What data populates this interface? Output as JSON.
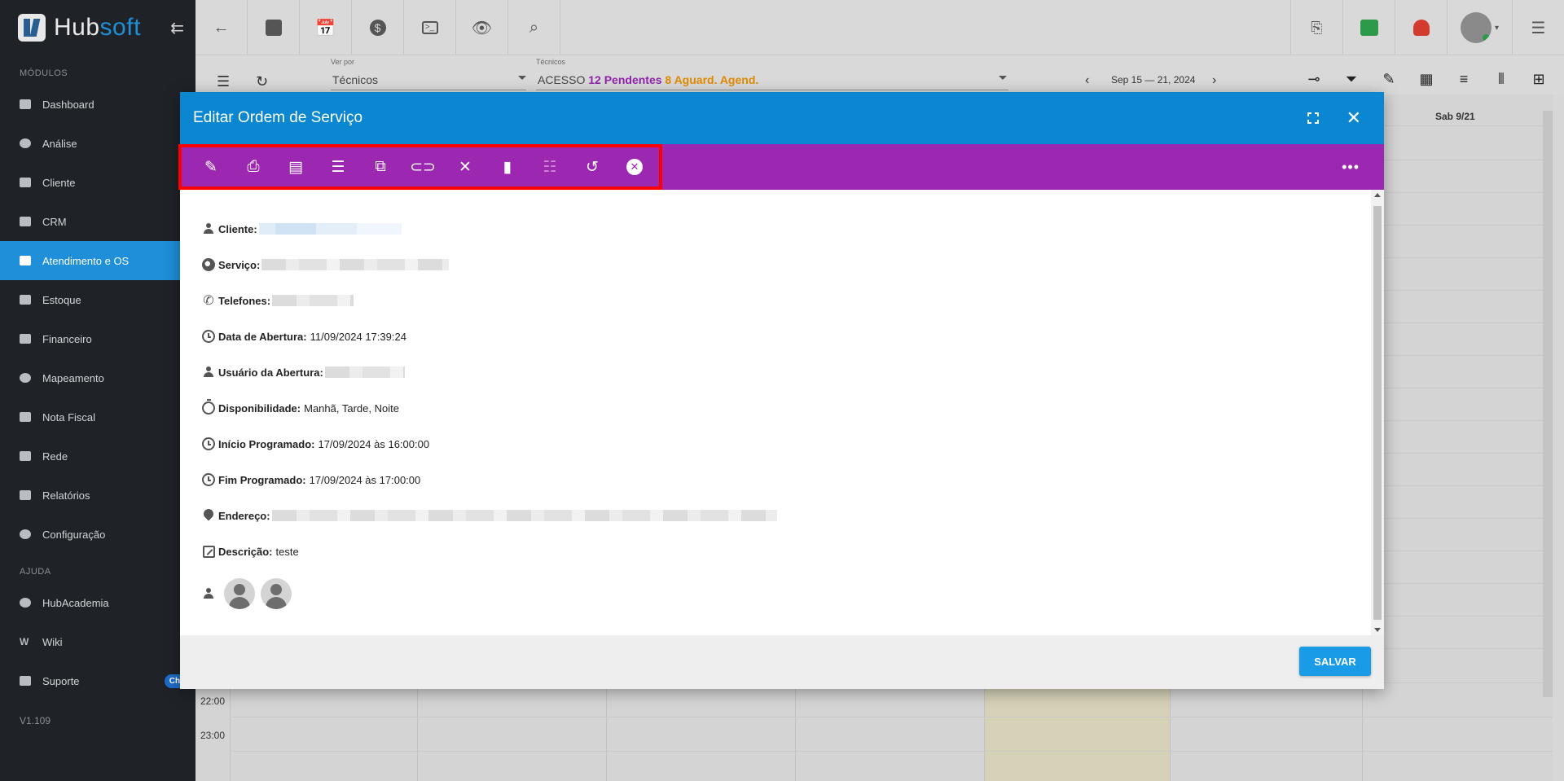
{
  "sidebar": {
    "brand_left": "Hub",
    "brand_right": "soft",
    "section_modules": "MÓDULOS",
    "items": [
      {
        "label": "Dashboard"
      },
      {
        "label": "Análise"
      },
      {
        "label": "Cliente"
      },
      {
        "label": "CRM"
      },
      {
        "label": "Atendimento e OS"
      },
      {
        "label": "Estoque"
      },
      {
        "label": "Financeiro"
      },
      {
        "label": "Mapeamento"
      },
      {
        "label": "Nota Fiscal"
      },
      {
        "label": "Rede"
      },
      {
        "label": "Relatórios"
      },
      {
        "label": "Configuração"
      }
    ],
    "section_help": "AJUDA",
    "help_items": [
      {
        "label": "HubAcademia"
      },
      {
        "label": "Wiki"
      },
      {
        "label": "Suporte"
      }
    ],
    "chat_badge": "Chat",
    "version": "V1.109"
  },
  "filterbar": {
    "ver_por_label": "Ver por",
    "ver_por_value": "Técnicos",
    "tecnicos_label": "Técnicos",
    "tecnicos_prefix": "ACESSO",
    "pendentes": "12 Pendentes",
    "aguard": "8 Aguard. Agend.",
    "date_range": "Sep 15 — 21, 2024"
  },
  "calendar": {
    "col_header": "Sab 9/21",
    "hours": [
      "22:00",
      "23:00"
    ]
  },
  "modal": {
    "title": "Editar Ordem de Serviço",
    "fields": {
      "cliente_label": "Cliente:",
      "servico_label": "Serviço:",
      "telefones_label": "Telefones:",
      "data_abertura_label": "Data de Abertura:",
      "data_abertura_value": "11/09/2024 17:39:24",
      "usuario_abertura_label": "Usuário da Abertura:",
      "disponibilidade_label": "Disponibilidade:",
      "disponibilidade_value": "Manhã, Tarde, Noite",
      "inicio_label": "Início Programado:",
      "inicio_value": "17/09/2024 às 16:00:00",
      "fim_label": "Fim Programado:",
      "fim_value": "17/09/2024 às 17:00:00",
      "endereco_label": "Endereço:",
      "descricao_label": "Descrição:",
      "descricao_value": "teste"
    },
    "save_label": "SALVAR"
  },
  "colors": {
    "header_blue": "#0b87d1",
    "toolbar_purple": "#9c27b0",
    "highlight_red": "#ff0000",
    "active_nav": "#1e8fd8",
    "save_button": "#1a9be8"
  }
}
